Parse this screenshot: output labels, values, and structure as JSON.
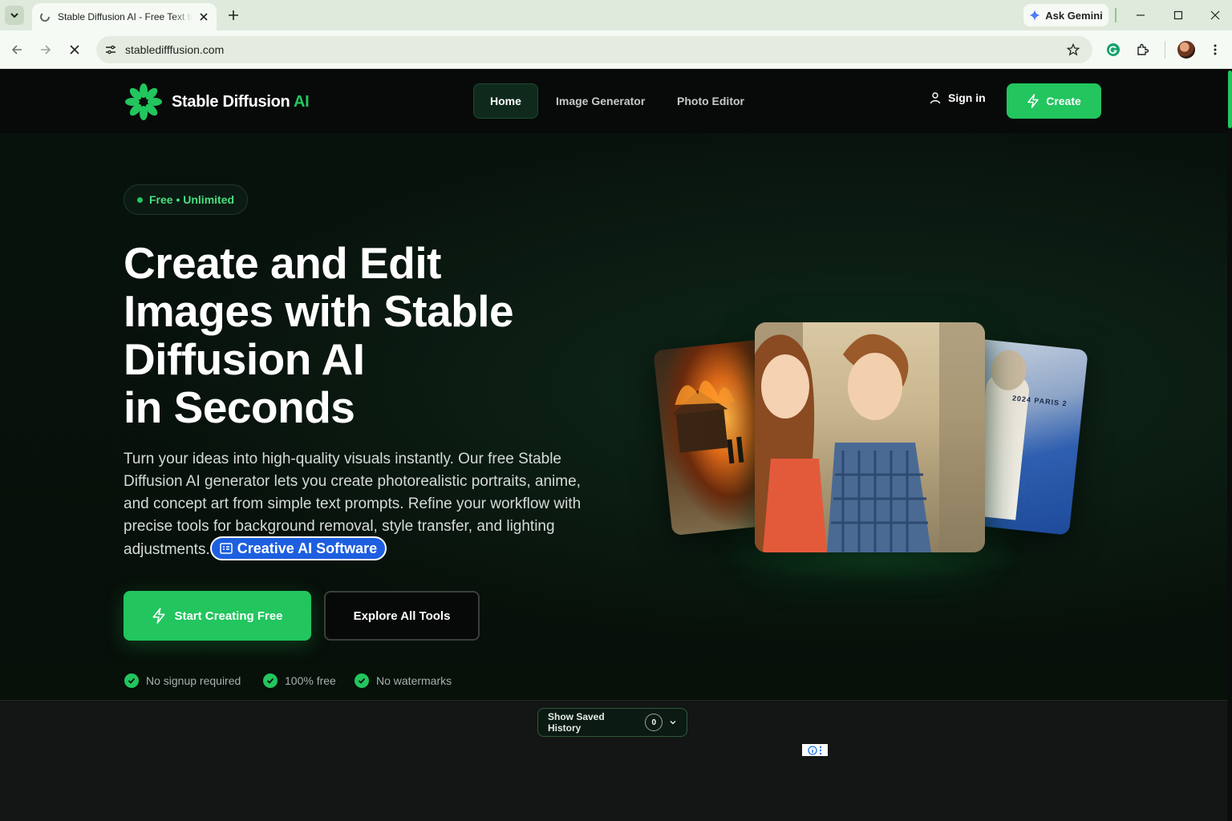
{
  "browser": {
    "tab_title": "Stable Diffusion AI - Free Text to Image",
    "url": "stabledifffusion.com",
    "gemini_label": "Ask Gemini"
  },
  "site": {
    "logo_text": "Stable Diffusion",
    "logo_ai": "AI",
    "nav": [
      "Home",
      "Image Generator",
      "Photo Editor"
    ],
    "signin": "Sign in",
    "create": "Create"
  },
  "hero": {
    "badge": "Free • Unlimited",
    "title_lines": [
      "Create and Edit",
      "Images with Stable",
      "Diffusion AI",
      "in Seconds"
    ],
    "description": "Turn your ideas into high-quality visuals instantly. Our free Stable Diffusion AI generator lets you create photorealistic portraits, anime, and concept art from simple text prompts. Refine your workflow with precise tools for background removal, style transfer, and lighting adjustments.",
    "ad_chip": "Creative AI Software",
    "primary_cta": "Start Creating Free",
    "secondary_cta": "Explore All Tools",
    "features": [
      "No signup required",
      "100% free",
      "No watermarks"
    ],
    "card_right_text": "2024  PARIS 2"
  },
  "history": {
    "label": "Show Saved History",
    "count": "0"
  },
  "colors": {
    "accent": "#22c55e",
    "background": "#0a0d0b",
    "ad_blue": "#1d5fe0"
  }
}
